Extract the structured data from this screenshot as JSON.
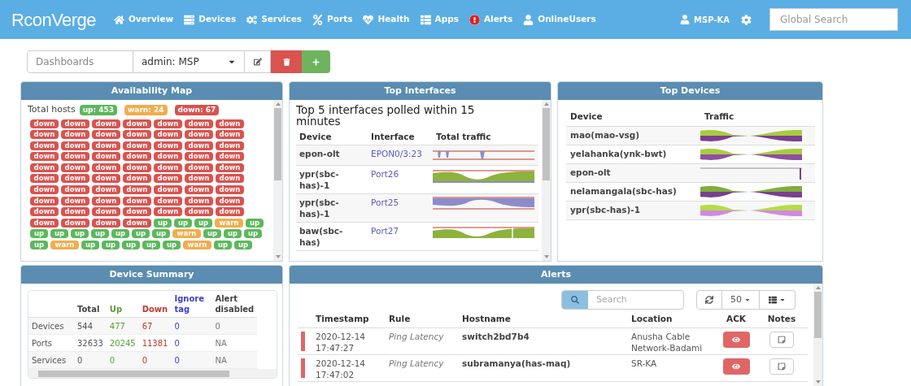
{
  "navbar": {
    "logo": "RconVerge",
    "items": [
      {
        "label": "Overview"
      },
      {
        "label": "Devices"
      },
      {
        "label": "Services"
      },
      {
        "label": "Ports"
      },
      {
        "label": "Health"
      },
      {
        "label": "Apps"
      },
      {
        "label": "Alerts"
      },
      {
        "label": "OnlineUsers"
      }
    ],
    "user": "MSP-KA",
    "search": {
      "placeholder": "Global Search"
    }
  },
  "toolbar": {
    "dashboards": {
      "placeholder": "Dashboards"
    },
    "dashboard_select": "admin: MSP"
  },
  "availability_map": {
    "title": "Availability Map",
    "total_label": "Total hosts",
    "totals": [
      {
        "text": "up: 453",
        "color": "#5cb85c"
      },
      {
        "text": "warn: 24",
        "color": "#f0ad4e"
      },
      {
        "text": "down: 67",
        "color": "#d9534f"
      }
    ],
    "hosts": [
      {
        "text": "down",
        "color": "#d9534f"
      },
      {
        "text": "down",
        "color": "#d9534f"
      },
      {
        "text": "down",
        "color": "#d9534f"
      },
      {
        "text": "down",
        "color": "#d9534f"
      },
      {
        "text": "down",
        "color": "#d9534f"
      },
      {
        "text": "down",
        "color": "#d9534f"
      },
      {
        "text": "down",
        "color": "#d9534f"
      },
      {
        "text": "down",
        "color": "#d9534f"
      },
      {
        "text": "down",
        "color": "#d9534f"
      },
      {
        "text": "down",
        "color": "#d9534f"
      },
      {
        "text": "down",
        "color": "#d9534f"
      },
      {
        "text": "down",
        "color": "#d9534f"
      },
      {
        "text": "down",
        "color": "#d9534f"
      },
      {
        "text": "down",
        "color": "#d9534f"
      },
      {
        "text": "down",
        "color": "#d9534f"
      },
      {
        "text": "down",
        "color": "#d9534f"
      },
      {
        "text": "down",
        "color": "#d9534f"
      },
      {
        "text": "down",
        "color": "#d9534f"
      },
      {
        "text": "down",
        "color": "#d9534f"
      },
      {
        "text": "down",
        "color": "#d9534f"
      },
      {
        "text": "down",
        "color": "#d9534f"
      },
      {
        "text": "down",
        "color": "#d9534f"
      },
      {
        "text": "down",
        "color": "#d9534f"
      },
      {
        "text": "down",
        "color": "#d9534f"
      },
      {
        "text": "down",
        "color": "#d9534f"
      },
      {
        "text": "down",
        "color": "#d9534f"
      },
      {
        "text": "down",
        "color": "#d9534f"
      },
      {
        "text": "down",
        "color": "#d9534f"
      },
      {
        "text": "down",
        "color": "#d9534f"
      },
      {
        "text": "down",
        "color": "#d9534f"
      },
      {
        "text": "down",
        "color": "#d9534f"
      },
      {
        "text": "down",
        "color": "#d9534f"
      },
      {
        "text": "down",
        "color": "#d9534f"
      },
      {
        "text": "down",
        "color": "#d9534f"
      },
      {
        "text": "down",
        "color": "#d9534f"
      },
      {
        "text": "down",
        "color": "#d9534f"
      },
      {
        "text": "down",
        "color": "#d9534f"
      },
      {
        "text": "down",
        "color": "#d9534f"
      },
      {
        "text": "down",
        "color": "#d9534f"
      },
      {
        "text": "down",
        "color": "#d9534f"
      },
      {
        "text": "down",
        "color": "#d9534f"
      },
      {
        "text": "down",
        "color": "#d9534f"
      },
      {
        "text": "down",
        "color": "#d9534f"
      },
      {
        "text": "down",
        "color": "#d9534f"
      },
      {
        "text": "down",
        "color": "#d9534f"
      },
      {
        "text": "down",
        "color": "#d9534f"
      },
      {
        "text": "down",
        "color": "#d9534f"
      },
      {
        "text": "down",
        "color": "#d9534f"
      },
      {
        "text": "down",
        "color": "#d9534f"
      },
      {
        "text": "down",
        "color": "#d9534f"
      },
      {
        "text": "down",
        "color": "#d9534f"
      },
      {
        "text": "down",
        "color": "#d9534f"
      },
      {
        "text": "down",
        "color": "#d9534f"
      },
      {
        "text": "down",
        "color": "#d9534f"
      },
      {
        "text": "down",
        "color": "#d9534f"
      },
      {
        "text": "down",
        "color": "#d9534f"
      },
      {
        "text": "down",
        "color": "#d9534f"
      },
      {
        "text": "down",
        "color": "#d9534f"
      },
      {
        "text": "down",
        "color": "#d9534f"
      },
      {
        "text": "down",
        "color": "#d9534f"
      },
      {
        "text": "down",
        "color": "#d9534f"
      },
      {
        "text": "down",
        "color": "#d9534f"
      },
      {
        "text": "down",
        "color": "#d9534f"
      },
      {
        "text": "down",
        "color": "#d9534f"
      },
      {
        "text": "down",
        "color": "#d9534f"
      },
      {
        "text": "down",
        "color": "#d9534f"
      },
      {
        "text": "down",
        "color": "#d9534f"
      },
      {
        "text": "up",
        "color": "#5cb85c"
      },
      {
        "text": "up",
        "color": "#5cb85c"
      },
      {
        "text": "up",
        "color": "#5cb85c"
      },
      {
        "text": "warn",
        "color": "#f0ad4e"
      },
      {
        "text": "up",
        "color": "#5cb85c"
      },
      {
        "text": "up",
        "color": "#5cb85c"
      },
      {
        "text": "up",
        "color": "#5cb85c"
      },
      {
        "text": "up",
        "color": "#5cb85c"
      },
      {
        "text": "up",
        "color": "#5cb85c"
      },
      {
        "text": "up",
        "color": "#5cb85c"
      },
      {
        "text": "up",
        "color": "#5cb85c"
      },
      {
        "text": "up",
        "color": "#5cb85c"
      },
      {
        "text": "warn",
        "color": "#f0ad4e"
      },
      {
        "text": "up",
        "color": "#5cb85c"
      },
      {
        "text": "up",
        "color": "#5cb85c"
      },
      {
        "text": "up",
        "color": "#5cb85c"
      },
      {
        "text": "up",
        "color": "#5cb85c"
      },
      {
        "text": "warn",
        "color": "#f0ad4e"
      },
      {
        "text": "up",
        "color": "#5cb85c"
      },
      {
        "text": "up",
        "color": "#5cb85c"
      },
      {
        "text": "up",
        "color": "#5cb85c"
      },
      {
        "text": "up",
        "color": "#5cb85c"
      },
      {
        "text": "up",
        "color": "#5cb85c"
      },
      {
        "text": "warn",
        "color": "#f0ad4e"
      },
      {
        "text": "up",
        "color": "#5cb85c"
      },
      {
        "text": "up",
        "color": "#5cb85c"
      }
    ]
  },
  "top_interfaces": {
    "title": "Top Interfaces",
    "heading": "Top 5 interfaces polled within 15 minutes",
    "columns": [
      "Device",
      "Interface",
      "Total traffic"
    ],
    "rows": [
      {
        "device": "epon-olt",
        "interface": "EPON0/3:23"
      },
      {
        "device": "ypr(sbc-has)-1",
        "interface": "Port26"
      },
      {
        "device": "ypr(sbc-has)-1",
        "interface": "Port25"
      },
      {
        "device": "baw(sbc-has)",
        "interface": "Port27"
      }
    ]
  },
  "top_devices": {
    "title": "Top Devices",
    "columns": [
      "Device",
      "Traffic"
    ],
    "rows": [
      {
        "device": "mao(mao-vsg)"
      },
      {
        "device": "yelahanka(ynk-bwt)"
      },
      {
        "device": "epon-olt"
      },
      {
        "device": "nelamangala(sbc-has)"
      },
      {
        "device": "ypr(sbc-has)-1"
      }
    ]
  },
  "device_summary": {
    "title": "Device Summary",
    "columns": [
      "",
      "Total",
      "Up",
      "Down",
      "Ignore tag",
      "Alert disabled"
    ],
    "rows": [
      [
        "Devices",
        "544",
        "477",
        "67",
        "0",
        "0"
      ],
      [
        "Ports",
        "32633",
        "20245",
        "11381",
        "0",
        "NA"
      ],
      [
        "Services",
        "0",
        "0",
        "0",
        "0",
        "NA"
      ]
    ]
  },
  "alerts": {
    "title": "Alerts",
    "search": {
      "placeholder": "Search"
    },
    "page_size": "50",
    "columns": [
      "Timestamp",
      "Rule",
      "Hostname",
      "Location",
      "ACK",
      "Notes"
    ],
    "rows": [
      {
        "color": "#e06666",
        "timestamp": "2020-12-14 17:47:27",
        "rule": "Ping Latency",
        "hostname": "switch2bd7b4",
        "location": "Anusha Cable Network-Badami"
      },
      {
        "color": "#e06666",
        "timestamp": "2020-12-14 17:47:02",
        "rule": "Ping Latency",
        "hostname": "subramanya(has-maq)",
        "location": "SR-KA"
      }
    ]
  }
}
